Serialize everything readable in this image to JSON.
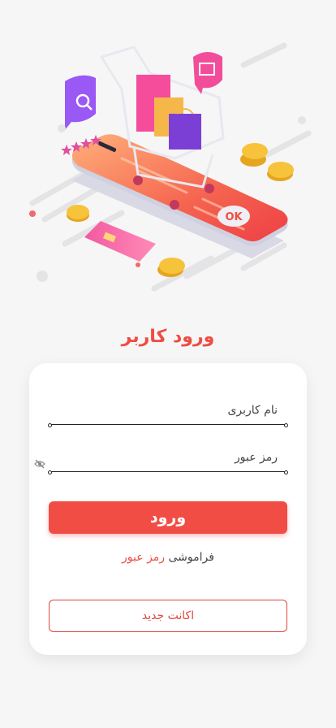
{
  "page": {
    "title": "ورود کاربر"
  },
  "form": {
    "username_label": "نام کاربری",
    "password_label": "رمز عبور",
    "login_label": "ورود",
    "forgot_prefix": "فراموشی",
    "forgot_link": "رمز عبور",
    "new_account_label": "اکانت جدید"
  },
  "hero": {
    "badge_text": "OK"
  },
  "colors": {
    "accent": "#f24d45",
    "background": "#f6f6f6"
  }
}
